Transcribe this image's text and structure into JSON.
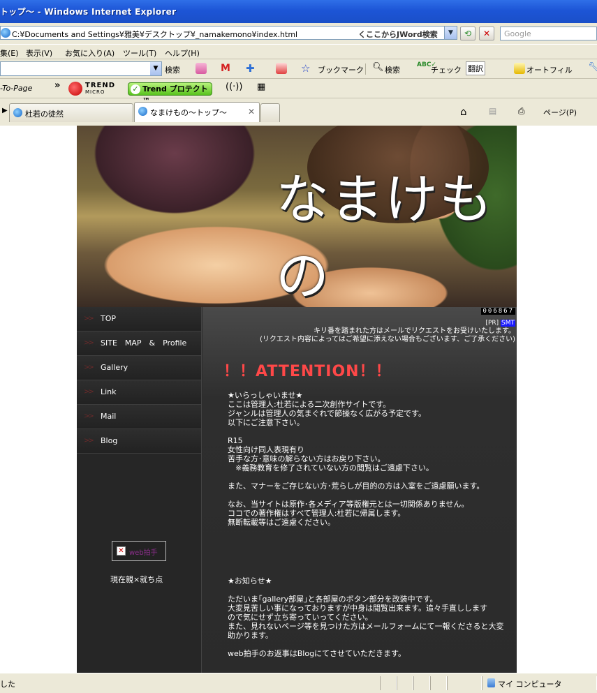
{
  "window": {
    "title": "トップ〜 - Windows Internet Explorer"
  },
  "addressbar": {
    "url": "C:¥Documents and Settings¥雅美¥デスクトップ¥_namakemono¥index.html",
    "jword": "くここからJWord検索",
    "search_placeholder": "Google"
  },
  "menu": [
    "集(E)",
    "表示(V)",
    "お気に入り(A)",
    "ツール(T)",
    "ヘルプ(H)"
  ],
  "toolbar1": {
    "search": "検索",
    "bookmark": "ブックマーク",
    "search2": "検索",
    "check": "チェック",
    "translate": "翻訳",
    "autofill": "オートフィル"
  },
  "toolbar2": {
    "to_page": "-To-Page",
    "trend_logo": "TREND",
    "trend_sub": "MICRO",
    "trend_protect": "Trend プロテクト™"
  },
  "tabs": [
    {
      "label": "杜若の徒然"
    },
    {
      "label": "なまけもの〜トップ〜"
    }
  ],
  "tabtools": {
    "page": "ページ(P)"
  },
  "site": {
    "header_title": "なまけもの",
    "nav": [
      "TOP",
      "SITE　MAP　&　Profile",
      "Gallery",
      "Link",
      "Mail",
      "Blog"
    ],
    "nav_arrow": ">>",
    "clap_label": "web拍手",
    "status": "現在親×就ち点",
    "counter": "006867",
    "pr_prefix": "[PR]",
    "pr_link": "SMT",
    "kiri_line1": "キリ番を踏まれた方はメールでリクエストをお受けいたします。",
    "kiri_line2": "(リクエスト内容によってはご希望に添えない場合もございます、ご了承ください)",
    "attention": "！！ATTENTION！！",
    "welcome": "★いらっしゃいませ★\nここは管理人:杜若による二次創作サイトです。\nジャンルは管理人の気まぐれで節操なく広がる予定です。\n以下にご注意下さい。\n\nR15\n女性向け同人表現有り\n苦手な方･意味の解らない方はお戻り下さい。\n　※義務教育を修了されていない方の閲覧はご遠慮下さい。\n\nまた、マナーをご存じない方･荒らしが目的の方は入室をご遠慮願います。\n\nなお、当サイトは原作･各メディア等版権元とは一切関係ありません。\nココでの著作権はすべて管理人:杜若に帰属します。\n無断転載等はご遠慮ください。",
    "news": "★お知らせ★\n\nただいま｢gallery部屋｣と各部屋のボタン部分を改装中です。\n大変見苦しい事になっておりますが中身は閲覧出来ます。追々手直しします\nので気にせず立ち寄っていってください。\nまた、見れないページ等を見つけた方はメールフォームにて一報くださると大変\n助かります。\n\nweb拍手のお返事はBlogにてさせていただきます。"
  },
  "statusbar": {
    "left": "した",
    "zone": "マイ コンピュータ"
  }
}
